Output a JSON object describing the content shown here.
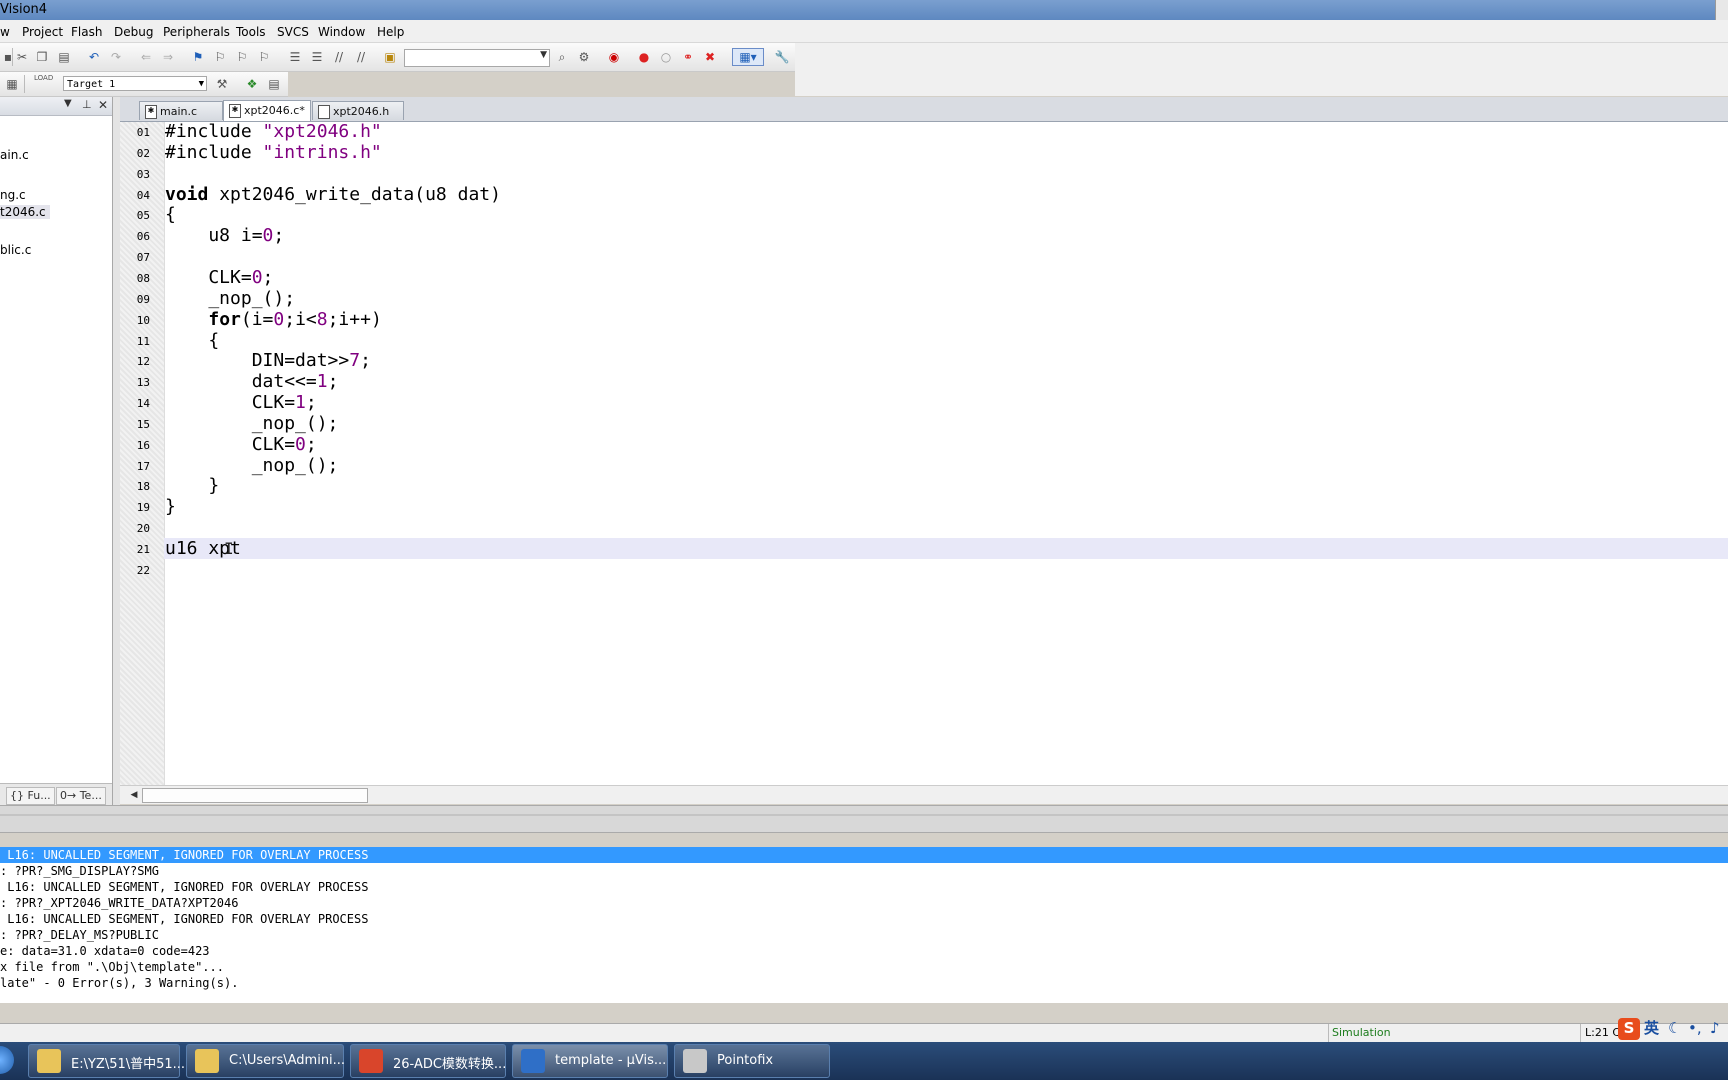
{
  "window": {
    "title": "Vision4"
  },
  "menu": [
    "w",
    "Project",
    "Flash",
    "Debug",
    "Peripherals",
    "Tools",
    "SVCS",
    "Window",
    "Help"
  ],
  "toolbar": {
    "target": "Target 1",
    "load_label": "LOAD"
  },
  "project_tree": [
    "ain.c",
    "ng.c",
    "t2046.c",
    "blic.c"
  ],
  "project_panel_tabs": [
    "{} Fu...",
    "0→ Te..."
  ],
  "editor_tabs": [
    {
      "label": "main.c"
    },
    {
      "label": "xpt2046.c*"
    },
    {
      "label": "xpt2046.h"
    }
  ],
  "code_lines": [
    {
      "no": "01",
      "text": "#include \"xpt2046.h\""
    },
    {
      "no": "02",
      "text": "#include \"intrins.h\""
    },
    {
      "no": "03",
      "text": ""
    },
    {
      "no": "04",
      "text": "void xpt2046_write_data(u8 dat)"
    },
    {
      "no": "05",
      "text": "{"
    },
    {
      "no": "06",
      "text": "    u8 i=0;"
    },
    {
      "no": "07",
      "text": ""
    },
    {
      "no": "08",
      "text": "    CLK=0;"
    },
    {
      "no": "09",
      "text": "    _nop_();"
    },
    {
      "no": "10",
      "text": "    for(i=0;i<8;i++)"
    },
    {
      "no": "11",
      "text": "    {"
    },
    {
      "no": "12",
      "text": "        DIN=dat>>7;"
    },
    {
      "no": "13",
      "text": "        dat<<=1;"
    },
    {
      "no": "14",
      "text": "        CLK=1;"
    },
    {
      "no": "15",
      "text": "        _nop_();"
    },
    {
      "no": "16",
      "text": "        CLK=0;"
    },
    {
      "no": "17",
      "text": "        _nop_();"
    },
    {
      "no": "18",
      "text": "    }"
    },
    {
      "no": "19",
      "text": "}"
    },
    {
      "no": "20",
      "text": ""
    },
    {
      "no": "21",
      "text": "u16 xpt"
    },
    {
      "no": "22",
      "text": ""
    }
  ],
  "current_line": "21",
  "build_output": [
    " L16: UNCALLED SEGMENT, IGNORED FOR OVERLAY PROCESS",
    ": ?PR?_SMG_DISPLAY?SMG",
    " L16: UNCALLED SEGMENT, IGNORED FOR OVERLAY PROCESS",
    ": ?PR?_XPT2046_WRITE_DATA?XPT2046",
    " L16: UNCALLED SEGMENT, IGNORED FOR OVERLAY PROCESS",
    ": ?PR?_DELAY_MS?PUBLIC",
    "e: data=31.0 xdata=0 code=423",
    "x file from \".\\Obj\\template\"...",
    "late\" - 0 Error(s), 3 Warning(s)."
  ],
  "status": {
    "mode": "Simulation",
    "position": "L:21 C:"
  },
  "ime": {
    "lang": "英"
  },
  "taskbar": [
    {
      "label": "E:\\YZ\\51\\普中51...",
      "icon": "folder-icon",
      "color": "#e8c45a"
    },
    {
      "label": "C:\\Users\\Admini...",
      "icon": "folder-icon",
      "color": "#e8c45a"
    },
    {
      "label": "26-ADC模数转换...",
      "icon": "powerpoint-icon",
      "color": "#d9452b"
    },
    {
      "label": "template  - µVis...",
      "icon": "uvision-icon",
      "color": "#2f6fc7"
    },
    {
      "label": "Pointofix",
      "icon": "pointofix-icon",
      "color": "#c8c8c8"
    }
  ]
}
